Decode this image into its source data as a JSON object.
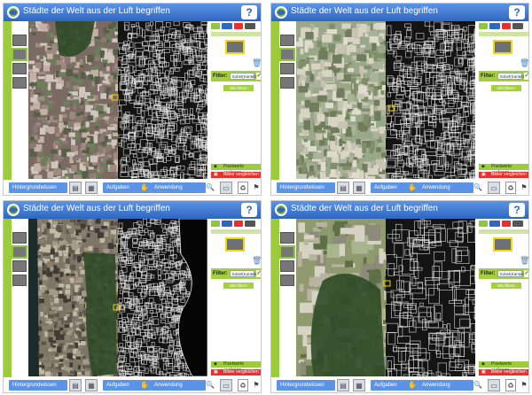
{
  "app": {
    "title": "Städte der Welt aus der Luft begriffen",
    "help_label": "?"
  },
  "right_panel": {
    "filter_label": "Filter:",
    "filter_value": "Sobel(Kanten)",
    "filter_ok": "✓",
    "apply_button": "Bild filtern",
    "pixel_button": "Pixelwerte auslesen",
    "compare_button": "Bilder vergleichen"
  },
  "bottom_nav": {
    "background_button": "Hintergrundwissen",
    "tasks_button": "Aufgaben",
    "application_button": "Anwendung"
  },
  "colors": {
    "header_blue": "#3f7ad1",
    "accent_green": "#9ccb3b",
    "accent_red": "#e8312f",
    "selection_yellow": "#f4d40a"
  },
  "icons": {
    "help": "question-icon",
    "trash": "trash-icon",
    "document": "document-icon",
    "picture": "picture-icon",
    "hand": "hand-icon",
    "magnifier": "magnifier-icon",
    "computer": "computer-icon",
    "recycle": "recycle-icon",
    "flag": "flag-icon"
  }
}
